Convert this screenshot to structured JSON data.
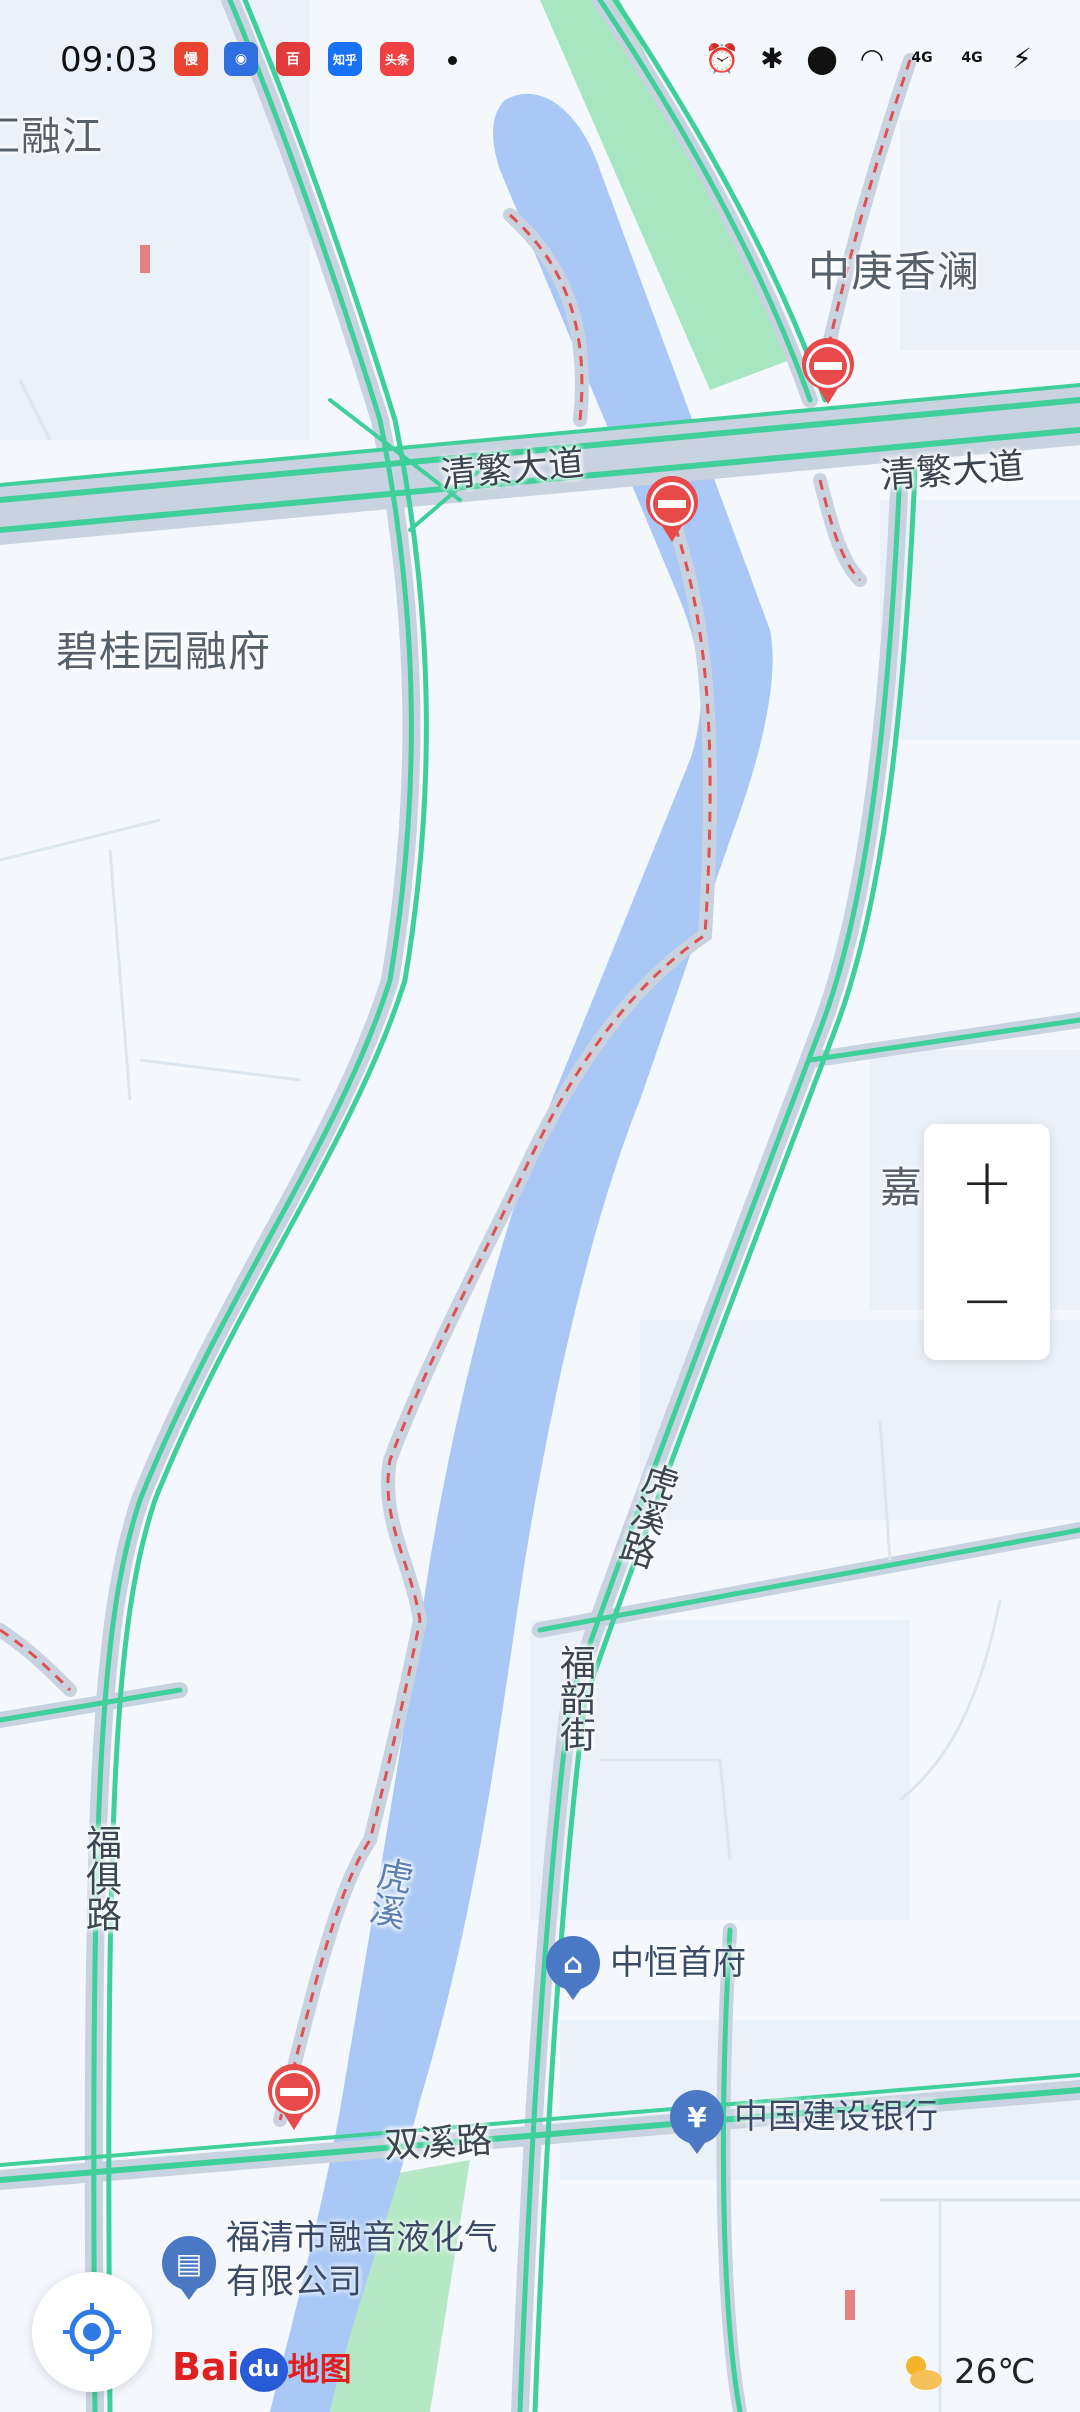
{
  "status_bar": {
    "time": "09:03",
    "apps": [
      {
        "icon": "man-app-icon",
        "glyph": "慢",
        "color": "#e8442f"
      },
      {
        "icon": "baidu-assistant-icon",
        "glyph": "◉",
        "color": "#2f6fe0"
      },
      {
        "icon": "baidu-wallet-icon",
        "glyph": "百",
        "color": "#e23b3b"
      },
      {
        "icon": "zhihu-app-icon",
        "glyph": "知乎",
        "color": "#1772f6"
      },
      {
        "icon": "toutiao-app-icon",
        "glyph": "头条",
        "color": "#f04142"
      }
    ],
    "network": "4G"
  },
  "map": {
    "areas": [
      "汇融江",
      "中庚香澜",
      "碧桂园融府",
      "嘉"
    ],
    "roads": {
      "qingfan_left": "清繁大道",
      "qingfan_right": "清繁大道",
      "huxi_road": "虎溪路",
      "fushao_street": "福韶街",
      "fuju_road": "福俱路",
      "shuangxi_road": "双溪路",
      "river": "虎溪"
    },
    "pois": [
      {
        "name": "中恒首府",
        "icon": "building-icon"
      },
      {
        "name": "中国建设银行",
        "icon": "bank-yuan-icon"
      },
      {
        "name_line1": "福清市融音液化气",
        "name_line2": "有限公司",
        "icon": "company-icon"
      }
    ]
  },
  "controls": {
    "zoom_in": "+",
    "zoom_out": "−"
  },
  "brand": {
    "logo_text_1": "Bai",
    "logo_text_2": "du",
    "logo_text_3": "地图"
  },
  "weather": {
    "temperature": "26℃",
    "icon": "partly-cloudy-icon"
  },
  "colors": {
    "water": "#a9c8f5",
    "road_fill": "#3fcf9a",
    "road_casing": "#c9d3e0",
    "park": "#a8e6c2",
    "restricted": "#e05050"
  }
}
